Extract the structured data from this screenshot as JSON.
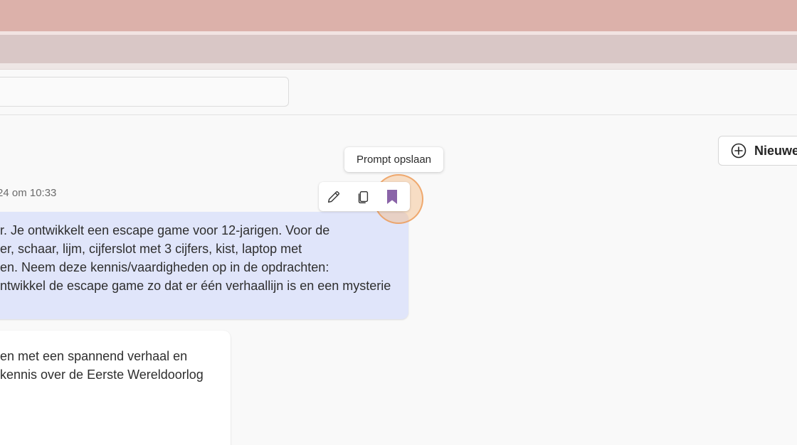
{
  "header": {
    "new_chat_label": "Nieuwe"
  },
  "tooltip": {
    "text": "Prompt opslaan"
  },
  "message_toolbar": {
    "edit_icon": "pencil-icon",
    "copy_icon": "copy-icon",
    "save_icon": "bookmark-icon"
  },
  "user_message": {
    "timestamp": "24 om 10:33",
    "lines": [
      "r. Je ontwikkelt een escape game voor 12-jarigen. Voor de",
      "er, schaar, lijm, cijferslot met 3 cijfers, kist, laptop met",
      "en. Neem deze kennis/vaardigheden op in de opdrachten:",
      "ntwikkel de escape game zo dat er één verhaallijn is en een mysterie"
    ]
  },
  "assistant_message": {
    "lines": [
      "en met een spannend verhaal en",
      "kennis over de Eerste Wereldoorlog"
    ]
  },
  "colors": {
    "accent_purple": "#8a64a8",
    "highlight_orange": "#f0a060",
    "user_bubble": "#e0e5fa"
  }
}
